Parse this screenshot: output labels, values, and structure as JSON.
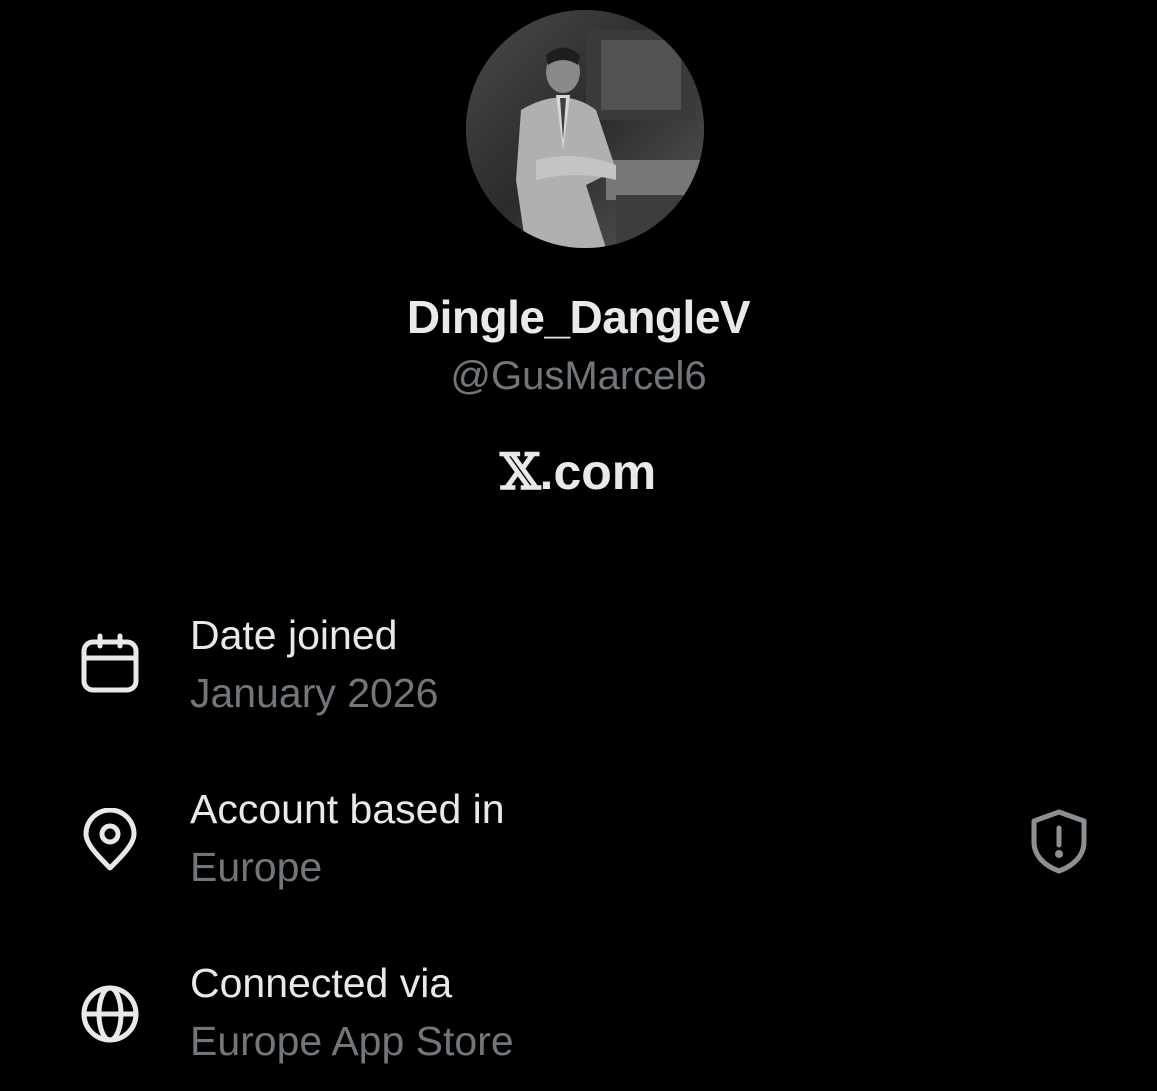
{
  "profile": {
    "display_name": "Dingle_DangleV",
    "handle": "@GusMarcel6",
    "site_prefix": "𝕏",
    "site_suffix": ".com"
  },
  "about": {
    "date_joined": {
      "label": "Date joined",
      "value": "January 2026",
      "icon": "calendar-icon"
    },
    "account_based_in": {
      "label": "Account based in",
      "value": "Europe",
      "icon": "location-pin-icon"
    },
    "connected_via": {
      "label": "Connected via",
      "value": "Europe App Store",
      "icon": "globe-icon"
    }
  },
  "colors": {
    "background": "#000000",
    "primary_text": "#e7e9ea",
    "secondary_text": "#71767b"
  }
}
